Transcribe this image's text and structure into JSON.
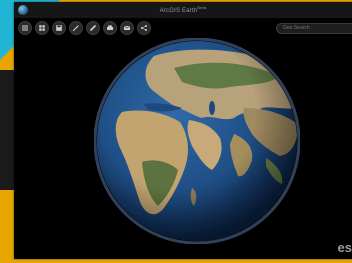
{
  "window": {
    "title": "ArcGIS Earth",
    "title_superscript": "Beta"
  },
  "toolbar": {
    "buttons": [
      {
        "name": "menu-button",
        "icon": "menu-icon"
      },
      {
        "name": "basemap-button",
        "icon": "layers-icon"
      },
      {
        "name": "save-button",
        "icon": "save-icon"
      },
      {
        "name": "draw-button",
        "icon": "pencil-icon"
      },
      {
        "name": "measure-button",
        "icon": "ruler-icon"
      },
      {
        "name": "print-button",
        "icon": "print-icon"
      },
      {
        "name": "email-button",
        "icon": "mail-icon"
      },
      {
        "name": "share-button",
        "icon": "share-icon"
      }
    ]
  },
  "search": {
    "placeholder": "Geo Search"
  },
  "watermark": {
    "text": "es"
  },
  "colors": {
    "background": "#e8a500",
    "accent_cyan": "#1fb5d3",
    "window_bg": "#000000",
    "ocean": "#1c4a80",
    "land": "#b8a27a"
  }
}
